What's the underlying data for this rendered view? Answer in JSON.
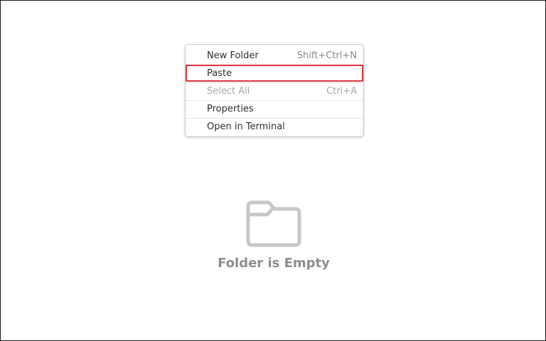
{
  "context_menu": {
    "items": [
      {
        "label": "New Folder",
        "accel": "Shift+Ctrl+N",
        "enabled": true
      },
      {
        "label": "Paste",
        "accel": "",
        "enabled": true,
        "highlighted": true
      },
      {
        "label": "Select All",
        "accel": "Ctrl+A",
        "enabled": false
      },
      {
        "label": "Properties",
        "accel": "",
        "enabled": true
      },
      {
        "label": "Open in Terminal",
        "accel": "",
        "enabled": true
      }
    ],
    "highlight_color": "#e0343f"
  },
  "empty_state": {
    "icon": "folder-icon",
    "message": "Folder is Empty"
  }
}
